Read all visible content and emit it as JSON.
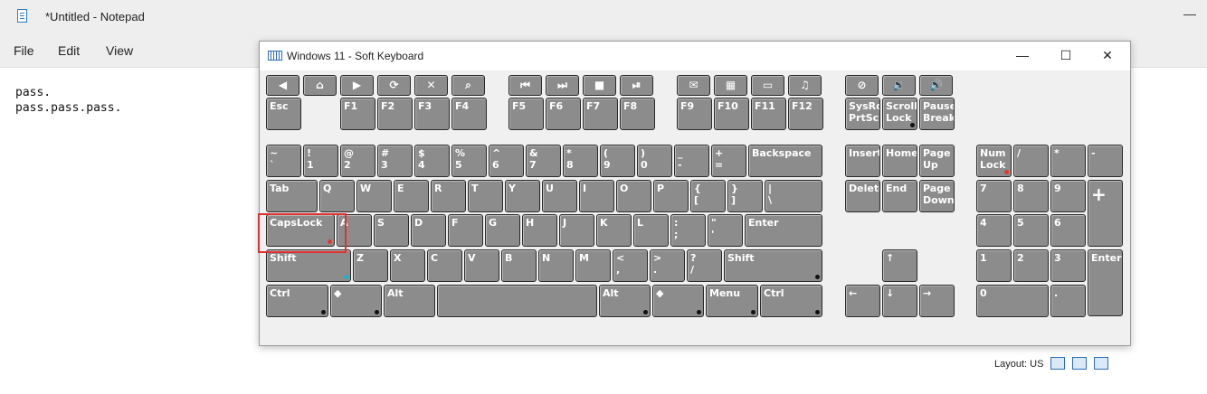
{
  "notepad": {
    "title": "*Untitled - Notepad",
    "minimize_glyph": "—",
    "menu": [
      "File",
      "Edit",
      "View"
    ],
    "lines": [
      "pass.",
      "pass.pass.pass."
    ]
  },
  "osk": {
    "title": "Windows 11 - Soft Keyboard",
    "window_buttons": {
      "minimize": "—",
      "maximize": "☐",
      "close": "✕"
    },
    "layout_label": "Layout: US",
    "icon_keys": [
      {
        "name": "back-key",
        "glyph": "◀"
      },
      {
        "name": "home-key",
        "glyph": "⌂"
      },
      {
        "name": "forward-key",
        "glyph": "▶"
      },
      {
        "name": "refresh-key",
        "glyph": "⟳"
      },
      {
        "name": "stop-key",
        "glyph": "✕"
      },
      {
        "name": "search-key",
        "glyph": "⌕"
      },
      {
        "name": "prev-track-key",
        "glyph": "⏮"
      },
      {
        "name": "next-track-key",
        "glyph": "⏭"
      },
      {
        "name": "stop-media-key",
        "glyph": "■"
      },
      {
        "name": "play-pause-key",
        "glyph": "⏯"
      },
      {
        "name": "mail-key",
        "glyph": "✉"
      },
      {
        "name": "calculator-key",
        "glyph": "▦"
      },
      {
        "name": "computer-key",
        "glyph": "▭"
      },
      {
        "name": "media-key",
        "glyph": "♫"
      },
      {
        "name": "mute-key",
        "glyph": "⊘"
      },
      {
        "name": "volume-down-key",
        "glyph": "🔉"
      },
      {
        "name": "volume-up-key",
        "glyph": "🔊"
      }
    ],
    "keys": {
      "esc": "Esc",
      "f1": "F1",
      "f2": "F2",
      "f3": "F3",
      "f4": "F4",
      "f5": "F5",
      "f6": "F6",
      "f7": "F7",
      "f8": "F8",
      "f9": "F9",
      "f10": "F10",
      "f11": "F11",
      "f12": "F12",
      "sysrq_1": "SysRq",
      "sysrq_2": "PrtScr",
      "scroll_1": "Scroll",
      "scroll_2": "Lock",
      "pause_1": "Pause",
      "pause_2": "Break",
      "tilde_1": "~",
      "tilde_2": "`",
      "k1_1": "!",
      "k1_2": "1",
      "k2_1": "@",
      "k2_2": "2",
      "k3_1": "#",
      "k3_2": "3",
      "k4_1": "$",
      "k4_2": "4",
      "k5_1": "%",
      "k5_2": "5",
      "k6_1": "^",
      "k6_2": "6",
      "k7_1": "&",
      "k7_2": "7",
      "k8_1": "*",
      "k8_2": "8",
      "k9_1": "(",
      "k9_2": "9",
      "k0_1": ")",
      "k0_2": "0",
      "minus_1": "_",
      "minus_2": "-",
      "plus_1": "+",
      "plus_2": "=",
      "backspace": "Backspace",
      "insert": "Insert",
      "home": "Home",
      "pageup_1": "Page",
      "pageup_2": "Up",
      "numlock_1": "Num",
      "numlock_2": "Lock",
      "np_div": "/",
      "np_mul": "*",
      "np_minus": "-",
      "tab": "Tab",
      "q": "Q",
      "w": "W",
      "e": "E",
      "r": "R",
      "t": "T",
      "y": "Y",
      "u": "U",
      "i": "I",
      "o": "O",
      "p": "P",
      "lbr_1": "{",
      "lbr_2": "[",
      "rbr_1": "}",
      "rbr_2": "]",
      "pipe_1": "|",
      "pipe_2": "\\",
      "delete": "Delete",
      "end": "End",
      "pagedown_1": "Page",
      "pagedown_2": "Down",
      "np7": "7",
      "np8": "8",
      "np9": "9",
      "np_plus": "+",
      "capslock": "CapsLock",
      "a": "A",
      "s": "S",
      "d": "D",
      "f": "F",
      "g": "G",
      "h": "H",
      "j": "J",
      "k": "K",
      "l": "L",
      "semi_1": ":",
      "semi_2": ";",
      "quote_1": "\"",
      "quote_2": "'",
      "enter": "Enter",
      "np4": "4",
      "np5": "5",
      "np6": "6",
      "lshift": "Shift",
      "z": "Z",
      "x": "X",
      "c": "C",
      "v": "V",
      "b": "B",
      "n": "N",
      "m": "M",
      "comma_1": "<",
      "comma_2": ",",
      "period_1": ">",
      "period_2": ".",
      "slash_1": "?",
      "slash_2": "/",
      "rshift": "Shift",
      "up": "↑",
      "np1": "1",
      "np2": "2",
      "np3": "3",
      "np_enter": "Enter",
      "lctrl": "Ctrl",
      "lwin": "◆",
      "lalt": "Alt",
      "ralt": "Alt",
      "rwin": "◆",
      "menu": "Menu",
      "rctrl": "Ctrl",
      "left": "←",
      "down": "↓",
      "right": "→",
      "np0": "0",
      "np_dot": "."
    }
  }
}
